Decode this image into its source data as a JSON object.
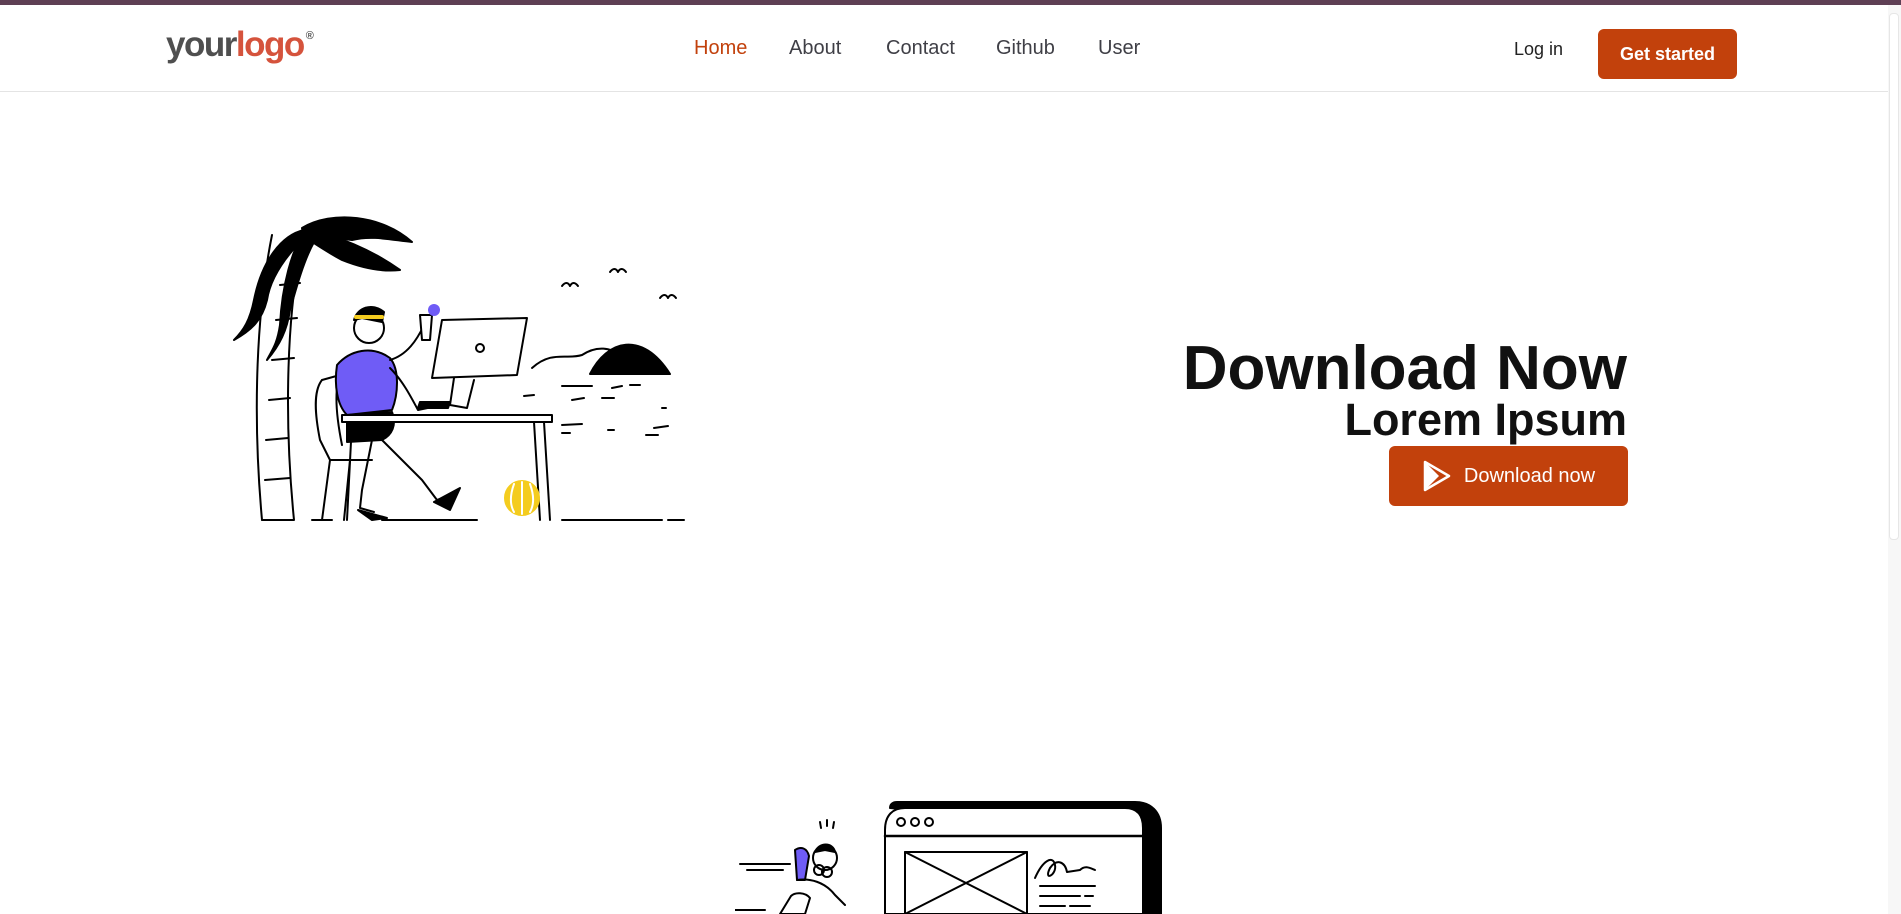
{
  "brand": {
    "logo_word1": "your",
    "logo_word2": "logo",
    "logo_mark": "®"
  },
  "nav": {
    "items": [
      {
        "label": "Home",
        "active": true
      },
      {
        "label": "About",
        "active": false
      },
      {
        "label": "Contact",
        "active": false
      },
      {
        "label": "Github",
        "active": false
      },
      {
        "label": "User",
        "active": false
      }
    ],
    "login_label": "Log in",
    "cta_label": "Get started"
  },
  "hero": {
    "title": "Download Now",
    "subtitle": "Lorem Ipsum",
    "button_label": "Download now",
    "button_icon": "play-store-icon"
  },
  "illustrations": {
    "hero": "beach-remote-work-illustration",
    "section2": "web-designer-illustration"
  },
  "colors": {
    "accent": "#c2410c",
    "top_strip": "#5e3f54",
    "logo_gray": "#4f4f4f",
    "logo_red": "#d5533c",
    "illustration_purple": "#6f5cf6",
    "illustration_yellow": "#f4cc1f"
  }
}
